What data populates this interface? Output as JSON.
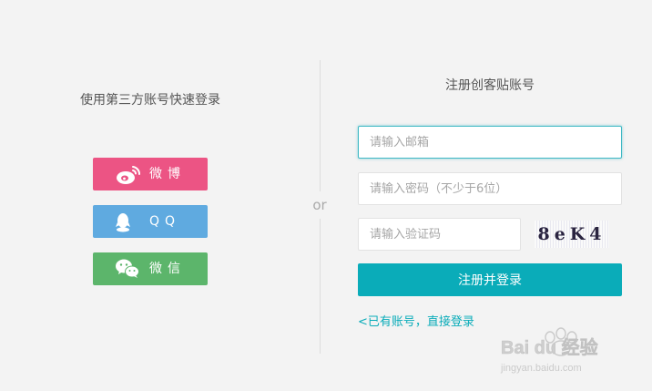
{
  "third_party": {
    "title": "使用第三方账号快速登录",
    "weibo_label": "微博",
    "qq_label": "QQ",
    "wechat_label": "微信",
    "weibo_color": "#ec5484",
    "qq_color": "#5faae0",
    "wechat_color": "#5cb56b"
  },
  "divider": {
    "or_text": "or"
  },
  "register": {
    "title": "注册创客贴账号",
    "email_placeholder": "请输入邮箱",
    "password_placeholder": "请输入密码（不少于6位）",
    "captcha_placeholder": "请输入验证码",
    "captcha_code": "8eK4",
    "submit_label": "注册并登录",
    "login_link": "<已有账号，直接登录",
    "accent_color": "#0aacb9"
  },
  "watermark": {
    "brand": "Bai du 经验",
    "url": "jingyan.baidu.com"
  }
}
